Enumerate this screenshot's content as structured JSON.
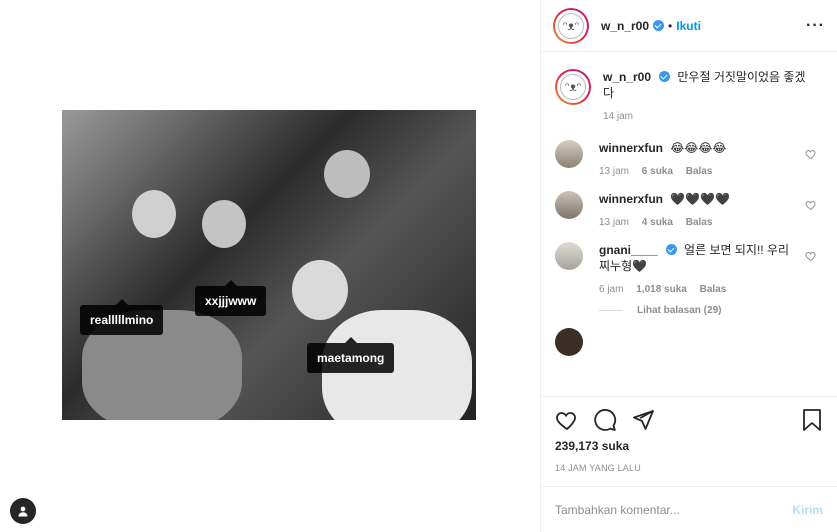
{
  "post": {
    "tags": [
      "realllllmino",
      "xxjjjwww",
      "maetamong"
    ]
  },
  "header": {
    "username": "w_n_r00",
    "separator": "•",
    "follow_label": "Ikuti",
    "more_label": "···"
  },
  "caption": {
    "username": "w_n_r00",
    "text": "만우절 거짓말이었음 좋겠다",
    "time": "14 jam"
  },
  "comments": [
    {
      "username": "winnerxfun",
      "text": "😂😂😂😂",
      "time": "13 jam",
      "likes": "6 suka",
      "reply": "Balas"
    },
    {
      "username": "winnerxfun",
      "text": "🖤🖤🖤🖤",
      "time": "13 jam",
      "likes": "4 suka",
      "reply": "Balas"
    },
    {
      "username": "gnani____",
      "text": "얼른 보면 되지!! 우리 찌누형🖤",
      "time": "6 jam",
      "likes": "1,018 suka",
      "reply": "Balas"
    }
  ],
  "view_replies": "Lihat balasan (29)",
  "actions": {
    "likes_count": "239,173 suka",
    "posted_ago": "14 JAM YANG LALU"
  },
  "add_comment": {
    "placeholder": "Tambahkan komentar...",
    "send_label": "Kirim"
  },
  "colors": {
    "accent": "#0095f6",
    "verified": "#3897f0",
    "muted": "#8e8e8e"
  }
}
